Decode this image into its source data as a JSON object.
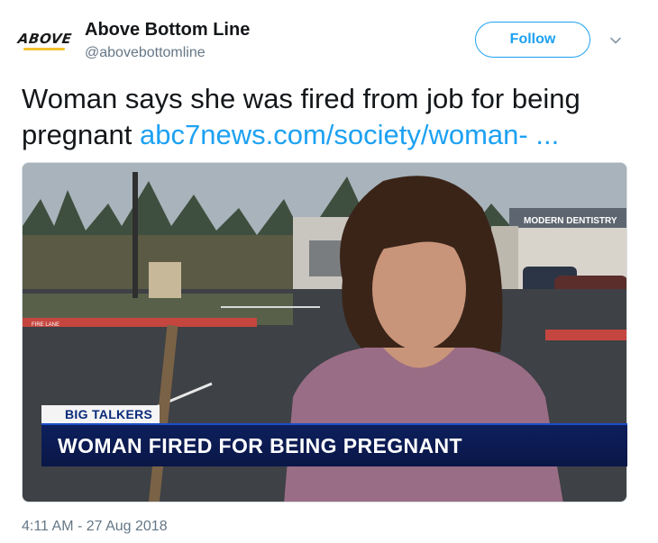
{
  "author": {
    "avatar_text": "ABOVE",
    "display_name": "Above Bottom Line",
    "handle": "@abovebottomline"
  },
  "follow_button": {
    "label": "Follow"
  },
  "tweet": {
    "text_line1": "Woman says she was fired from job for being",
    "text_line2": "pregnant ",
    "link_text": "abc7news.com/society/woman-  ...",
    "timestamp": "4:11 AM - 27 Aug 2018"
  },
  "media": {
    "sign_text": "MODERN DENTISTRY",
    "lane_text": "FIRE LANE",
    "chyron_tag": "BIG TALKERS",
    "chyron_headline": "WOMAN FIRED FOR BEING PREGNANT"
  },
  "colors": {
    "link": "#1da1f2",
    "muted": "#657786",
    "chyron_bg": "#0a1747"
  }
}
